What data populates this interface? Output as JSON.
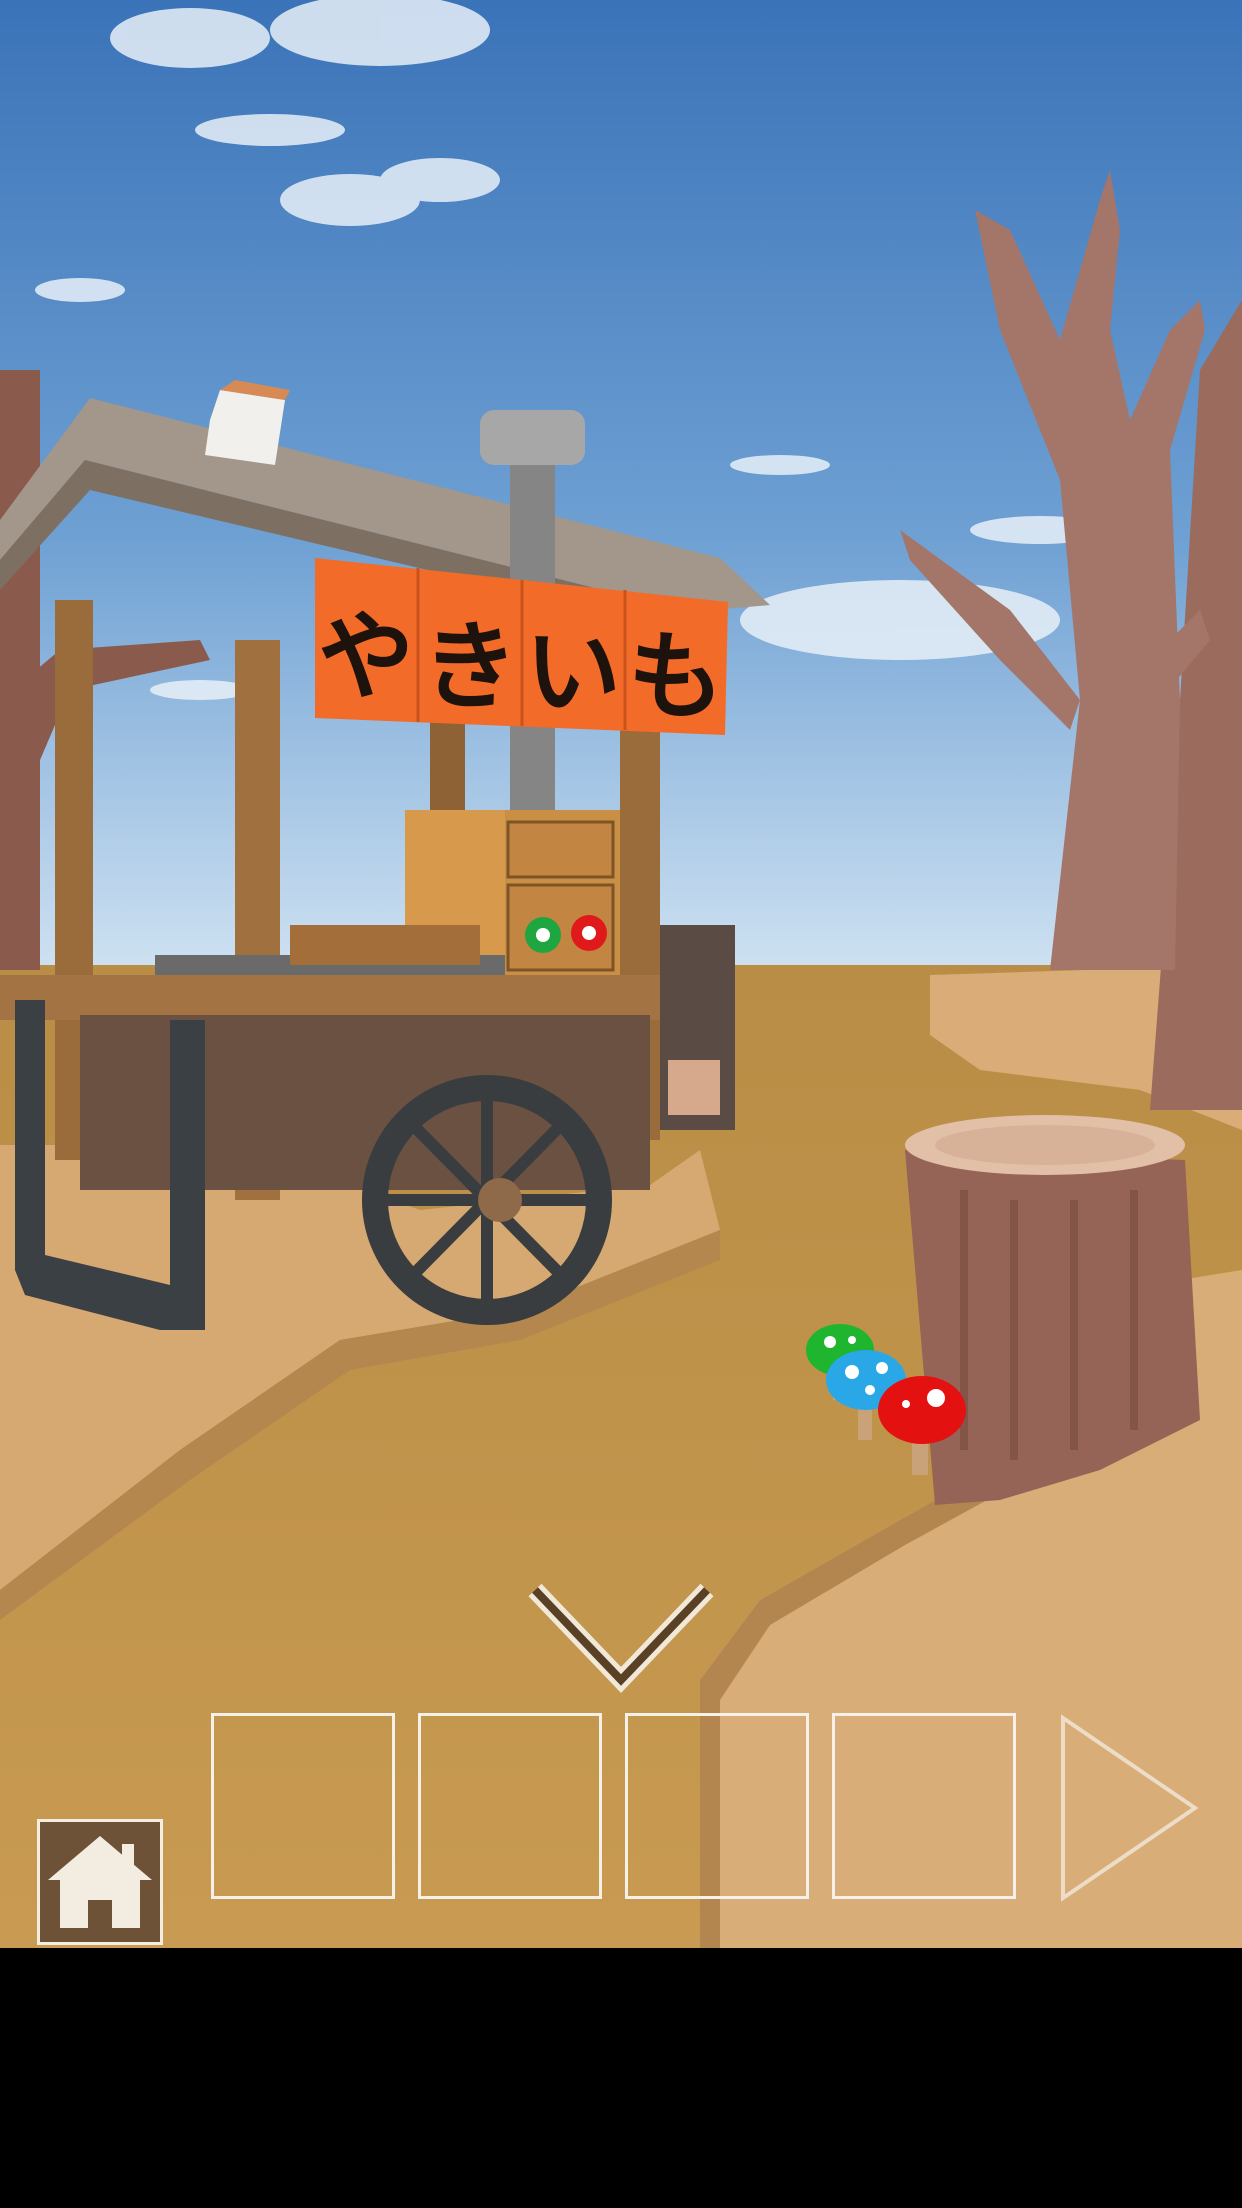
{
  "game": {
    "stall_sign_chars": [
      "や",
      "き",
      "い",
      "も"
    ],
    "inventory_slots": [
      {
        "item": ""
      },
      {
        "item": ""
      },
      {
        "item": ""
      },
      {
        "item": ""
      }
    ],
    "navigation": {
      "back_icon": "chevron-down-icon",
      "next_icon": "triangle-right-icon",
      "home_icon": "house-icon"
    },
    "mushroom_colors": [
      "#1fb52e",
      "#2aa7e6",
      "#e41111"
    ],
    "drawer_button_colors": [
      "#1fa640",
      "#e01a1a"
    ]
  }
}
